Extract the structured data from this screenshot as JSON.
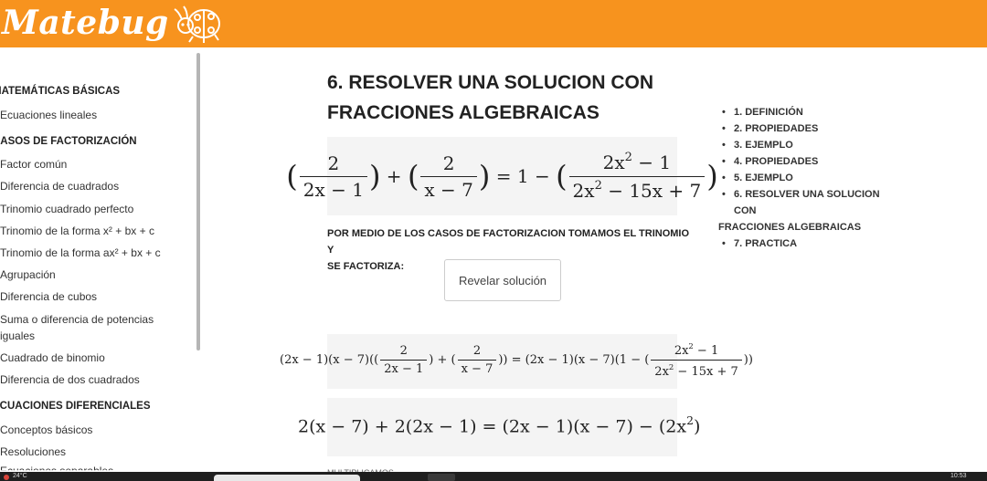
{
  "brand": {
    "logo_text": "Matebug",
    "accent": "#f7931e"
  },
  "sidebar": {
    "sections": [
      {
        "heading": "MATEMÁTICAS BÁSICAS",
        "items": [
          "Ecuaciones lineales"
        ]
      },
      {
        "heading": "CASOS DE FACTORIZACIÓN",
        "items": [
          "Factor común",
          "Diferencia de cuadrados",
          "Trinomio cuadrado perfecto",
          "Trinomio de la forma x² + bx + c",
          "Trinomio de la forma ax² + bx + c",
          "Agrupación",
          "Diferencia de cubos",
          "Suma o diferencia de potencias",
          "iguales",
          "Cuadrado de binomio",
          "Diferencia de dos cuadrados"
        ]
      },
      {
        "heading": "ECUACIONES DIFERENCIALES",
        "items": [
          "Conceptos básicos",
          "Resoluciones",
          "Ecuaciones separables"
        ]
      }
    ]
  },
  "main": {
    "title_line1": "6. RESOLVER UNA SOLUCION CON",
    "title_line2": "FRACCIONES ALGEBRAICAS",
    "paragraph_line1": "POR MEDIO DE LOS CASOS DE FACTORIZACION TOMAMOS EL TRINOMIO Y",
    "paragraph_line2": "SE FACTORIZA:",
    "reveal_button": "Revelar solución",
    "bottom_cut_text": "MULTIPLICAMOS"
  },
  "toc": {
    "items": [
      "1. DEFINICIÓN",
      "2. PROPIEDADES",
      "3. EJEMPLO",
      "4. PROPIEDADES",
      "5. EJEMPLO",
      "6. RESOLVER UNA SOLUCION CON",
      "7. PRACTICA"
    ],
    "item6_wrap": "FRACCIONES ALGEBRAICAS"
  },
  "taskbar": {
    "left_text": "24°C",
    "right_text": "10:53"
  }
}
